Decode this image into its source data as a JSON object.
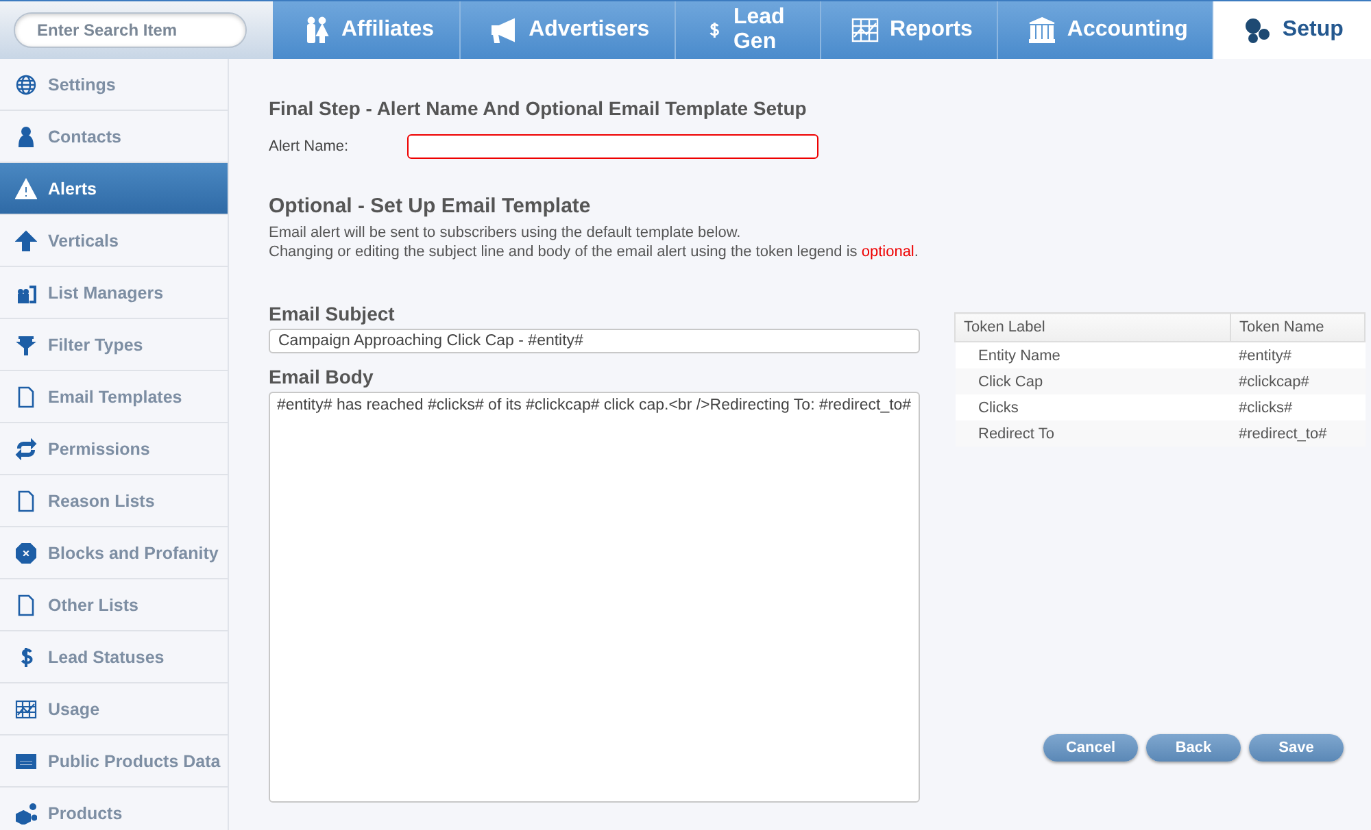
{
  "search": {
    "placeholder": "Enter Search Item"
  },
  "tabs": [
    {
      "label": "Affiliates",
      "selected": false
    },
    {
      "label": "Advertisers",
      "selected": false
    },
    {
      "label": "Lead Gen",
      "selected": false
    },
    {
      "label": "Reports",
      "selected": false
    },
    {
      "label": "Accounting",
      "selected": false
    },
    {
      "label": "Setup",
      "selected": true
    }
  ],
  "sidebar": {
    "items": [
      {
        "label": "Settings",
        "selected": false
      },
      {
        "label": "Contacts",
        "selected": false
      },
      {
        "label": "Alerts",
        "selected": true
      },
      {
        "label": "Verticals",
        "selected": false
      },
      {
        "label": "List Managers",
        "selected": false
      },
      {
        "label": "Filter Types",
        "selected": false
      },
      {
        "label": "Email Templates",
        "selected": false
      },
      {
        "label": "Permissions",
        "selected": false
      },
      {
        "label": "Reason Lists",
        "selected": false
      },
      {
        "label": "Blocks and Profanity",
        "selected": false
      },
      {
        "label": "Other Lists",
        "selected": false
      },
      {
        "label": "Lead Statuses",
        "selected": false
      },
      {
        "label": "Usage",
        "selected": false
      },
      {
        "label": "Public Products Data",
        "selected": false
      },
      {
        "label": "Products",
        "selected": false
      }
    ]
  },
  "form": {
    "title": "Final Step - Alert Name And Optional Email Template Setup",
    "alert_name": {
      "label": "Alert Name:",
      "invalid": true
    },
    "template_title": "Optional - Set Up Email Template",
    "description": [
      "Email alert will be sent to subscribers using the default template below."
    ],
    "note": {
      "text": "Changing or editing the subject line and body of the email alert using the token legend is ",
      "highlight": "optional",
      "end": "."
    },
    "subject": {
      "label": "Email Subject",
      "value": "Campaign Approaching Click Cap - #entity#"
    },
    "body": {
      "label": "Email Body",
      "value": "#entity# has reached #clicks# of its #clickcap# click cap.<br />Redirecting To: #redirect_to#"
    }
  },
  "token_table": {
    "columns": [
      "Token Label",
      "Token Name"
    ],
    "rows": [
      [
        "Entity Name",
        "#entity#"
      ],
      [
        "Click Cap",
        "#clickcap#"
      ],
      [
        "Clicks",
        "#clicks#"
      ],
      [
        "Redirect To",
        "#redirect_to#"
      ]
    ]
  },
  "buttons": [
    "Cancel",
    "Back",
    "Save"
  ]
}
